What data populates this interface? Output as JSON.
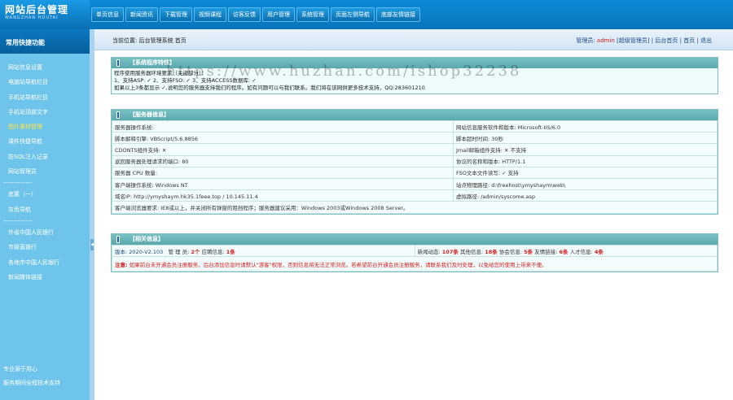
{
  "header": {
    "logo_title": "网站后台管理",
    "logo_sub": "WANGZHAN HOUTAI",
    "nav": [
      "单页信息",
      "新闻资讯",
      "下载管理",
      "视频课程",
      "访客反馈",
      "用户管理",
      "系统管理",
      "页面左侧导航",
      "底部友情链接"
    ]
  },
  "sidebar": {
    "title": "常用快捷功能",
    "items": [
      {
        "label": "网站信息设置",
        "active": false
      },
      {
        "label": "电脑站导航栏目",
        "active": false
      },
      {
        "label": "手机站导航栏目",
        "active": false
      },
      {
        "label": "手机站顶部文字",
        "active": false
      },
      {
        "label": "图片素材管理",
        "active": true
      },
      {
        "label": "课件快捷导航",
        "active": false
      },
      {
        "label": "防SQL注入记录",
        "active": false
      },
      {
        "label": "网站管理员",
        "active": false
      }
    ],
    "sep1": "--------------",
    "items2": [
      {
        "label": "底置（一）"
      },
      {
        "label": "灰色导航"
      }
    ],
    "sep2": "--------------",
    "items3": [
      {
        "label": "外省中国人民银行"
      },
      {
        "label": "市级直银行"
      },
      {
        "label": "各地市中国人民银行"
      },
      {
        "label": "新闻媒体链接"
      }
    ],
    "footer": [
      "专业源于用心",
      "服务期间全程技术支持"
    ]
  },
  "content": {
    "breadcrumb": "当前位置: 后台管理系统 首页",
    "user_prefix": "管理员:",
    "user_name": "admin",
    "user_role": "[超级管理员]",
    "user_links": "| 后台首页 | 首页 | 退出",
    "watermark": "https://www.huzhan.com/ishop32238"
  },
  "panel1": {
    "title": "【系统程序特性】",
    "lines": [
      "程序使用服务器环境要求（关键部分）：",
      "1、支持ASP: ✓  2、支持FSO: ✓  3、支持ACCESS数据库: ✓",
      "如果以上3条都显示 ✓,说明您的服务器支持我们的程序。如有问题可以与我们联系。我们将在该网供更多技术支持，QQ:283601210"
    ]
  },
  "panel2": {
    "title": "【服务器信息】",
    "rows": [
      [
        "服务器操作系统:",
        "网站信息服务软件和版本: Microsoft-IIS/6.0"
      ],
      [
        "脚本解释引擎: VBScript/5.6.8856",
        "脚本超时时间: 30秒"
      ],
      [
        "CDONTS组件支持: ✕",
        "Jmail邮箱组件支持: ✕ 不支持"
      ],
      [
        "返回服务器处理请求的端口: 80",
        "协议的名称和版本: HTTP/1.1"
      ],
      [
        "服务器 CPU 数量:",
        "FSO文本文件读写: ✓ 支持"
      ],
      [
        "客户端操作系统:  Windows NT",
        "站点物理路径: d:\\freehost\\ymyshaym\\web\\"
      ],
      [
        "域名IP: http://ymyshaym.hk35.1feee.top / 10.145.11.4",
        "虚拟路径: /admin/syscome.asp"
      ]
    ],
    "last_row": "客户端浏览器要求:  IE8或以上，并关闭所有弹窗的阻挡程序；服务器建议采用：Windows 2003或Windows 2008 Server。"
  },
  "panel3": {
    "title": "【相关信息】",
    "version_label": "版本:",
    "version": "2020-V2.103",
    "stats_left": [
      {
        "label": "管 理 员:",
        "value": "2个"
      },
      {
        "label": "应聘信息:",
        "value": "1条"
      }
    ],
    "stats_right": [
      {
        "label": "新闻动态:",
        "value": "107条"
      },
      {
        "label": "其他信息:",
        "value": "18条"
      },
      {
        "label": "协会信息:",
        "value": "5条"
      },
      {
        "label": "友情链接:",
        "value": "6条"
      },
      {
        "label": "人才信息:",
        "value": "4条"
      }
    ],
    "notice_label": "注意:",
    "notice": "如果前台未开通会员注册服务，后台添加信息时请默认\"游客\"权限，否则信息将无法正常浏览。若希望前台开通会员注册服务，请联系我们及时处理，以免给您的使用上带来不便。"
  }
}
